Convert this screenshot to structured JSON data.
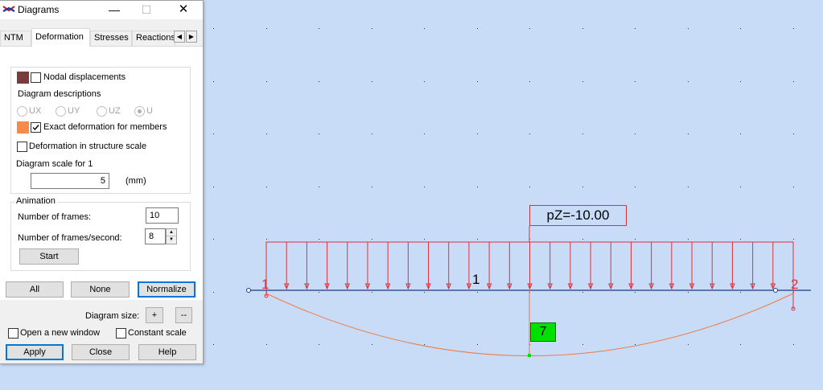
{
  "window": {
    "title": "Diagrams",
    "minimize": "—",
    "maximize": "☐",
    "close": "✕"
  },
  "tabs": [
    {
      "label": "NTM"
    },
    {
      "label": "Deformation"
    },
    {
      "label": "Stresses"
    },
    {
      "label": "Reactions"
    }
  ],
  "tab_scroll": {
    "left": "◀",
    "right": "▶"
  },
  "deformation": {
    "nodal_displacements": {
      "label": "Nodal displacements",
      "checked": false,
      "color": "#7a3b3b"
    },
    "diagram_descriptions": {
      "label": "Diagram descriptions",
      "options": [
        "UX",
        "UY",
        "UZ",
        "U"
      ],
      "selected": "U",
      "enabled": false
    },
    "exact_deformation": {
      "label": "Exact deformation for members",
      "checked": true,
      "color": "#f58a4a"
    },
    "structure_scale": {
      "label": "Deformation in structure scale",
      "checked": false
    },
    "diagram_scale": {
      "label": "Diagram scale for 1",
      "value": "5",
      "unit": "(mm)"
    }
  },
  "animation": {
    "group_label": "Animation",
    "frames_label": "Number of frames:",
    "frames_value": "10",
    "fps_label": "Number of frames/second:",
    "fps_value": "8",
    "start_label": "Start"
  },
  "bottom": {
    "all_label": "All",
    "none_label": "None",
    "normalize_label": "Normalize",
    "diagram_size_label": "Diagram size:",
    "plus_label": "+",
    "minus_label": "--",
    "open_new_window": {
      "label": "Open a new window",
      "checked": false
    },
    "constant_scale": {
      "label": "Constant scale",
      "checked": false
    },
    "apply_label": "Apply",
    "close_label": "Close",
    "help_label": "Help"
  },
  "drawing": {
    "load_label": "pZ=-10.00",
    "node_1": "1",
    "node_2": "2",
    "member_1": "1",
    "result_label": "7",
    "colors": {
      "load": "#e0303a",
      "member": "#1a3a8a",
      "deformation": "#f07840",
      "background": "#c8dcf8",
      "result": "#00e000"
    }
  }
}
